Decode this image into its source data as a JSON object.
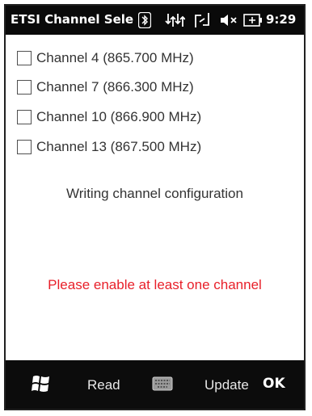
{
  "titlebar": {
    "title": "ETSI Channel Selec",
    "time": "9:29",
    "icons": [
      "bluetooth-icon",
      "data-connection-icon",
      "network-icon",
      "volume-muted-icon",
      "battery-icon"
    ]
  },
  "channels": [
    {
      "label": "Channel 4 (865.700 MHz)",
      "checked": false
    },
    {
      "label": "Channel 7 (866.300 MHz)",
      "checked": false
    },
    {
      "label": "Channel 10 (866.900 MHz)",
      "checked": false
    },
    {
      "label": "Channel 13 (867.500 MHz)",
      "checked": false
    }
  ],
  "status_text": "Writing channel configuration",
  "error_text": "Please enable at least one channel",
  "softkeys": {
    "start_icon": "windows-start-icon",
    "read": "Read",
    "keyboard_icon": "keyboard-icon",
    "update": "Update",
    "ok": "OK"
  },
  "colors": {
    "bar_background": "#0a0a0a",
    "error": "#e8202a",
    "text": "#333333"
  }
}
